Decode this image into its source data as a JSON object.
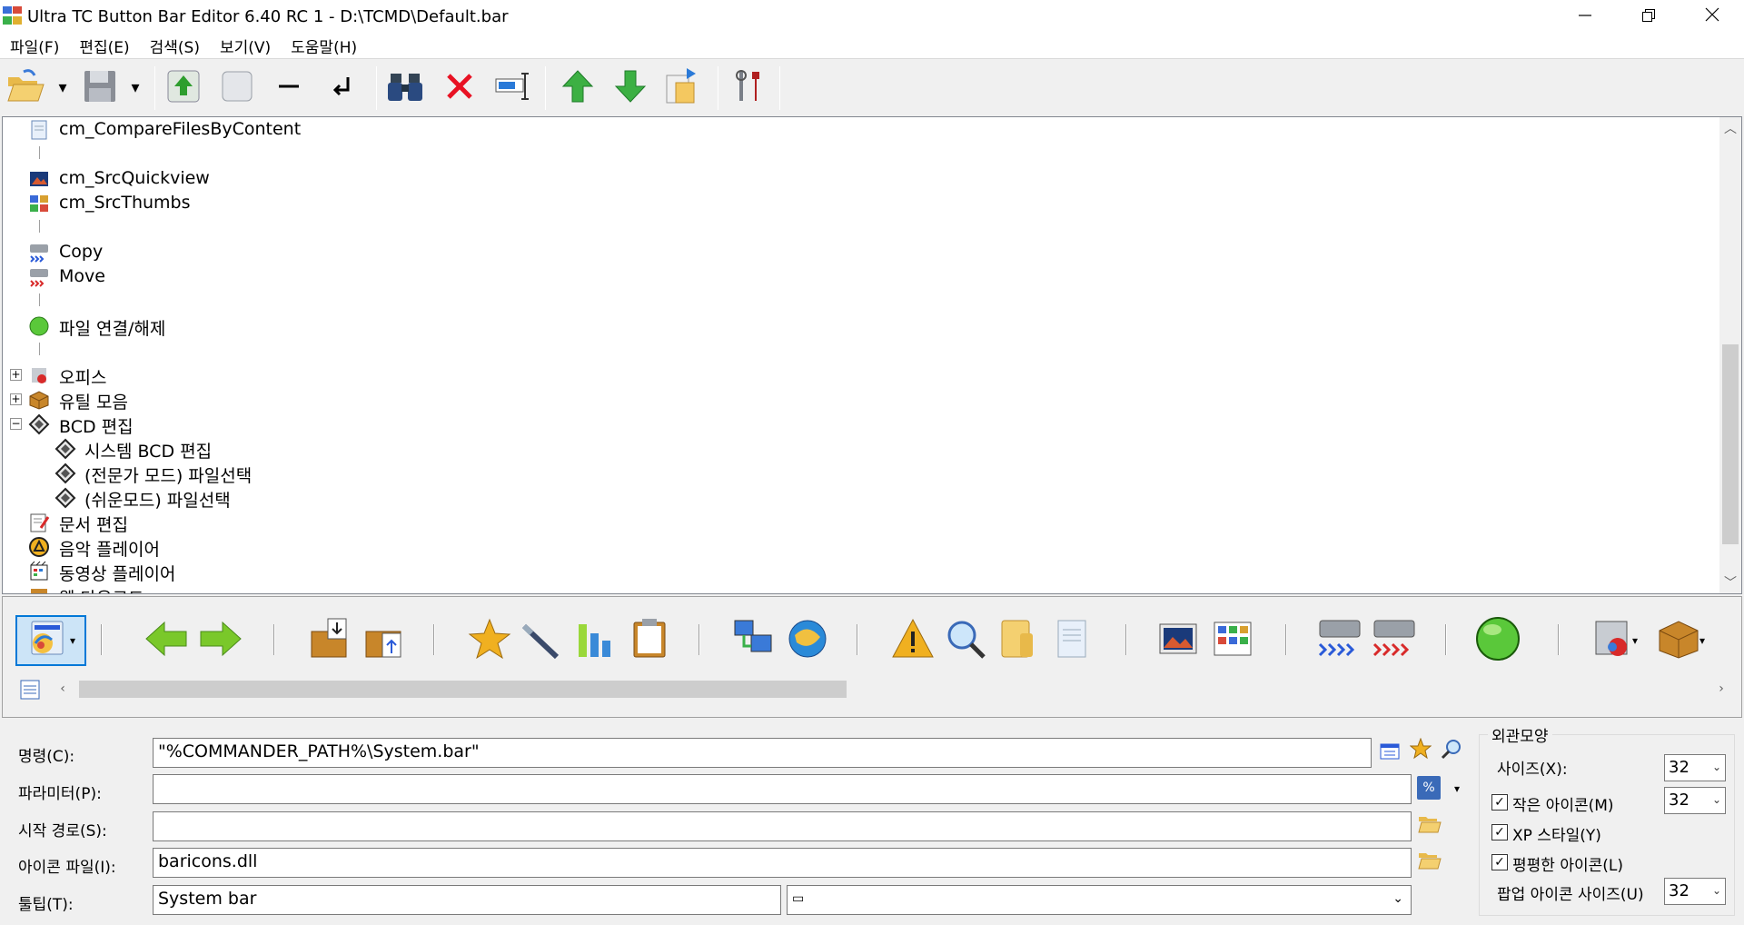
{
  "window": {
    "title": "Ultra TC Button Bar Editor 6.40 RC 1 - D:\\TCMD\\Default.bar"
  },
  "menu": [
    "파일(F)",
    "편집(E)",
    "검색(S)",
    "보기(V)",
    "도움말(H)"
  ],
  "tree": {
    "items": [
      {
        "label": "cm_CompareFilesByContent",
        "icon": "compare-files-icon"
      },
      {
        "label": "cm_SrcQuickview",
        "icon": "quickview-icon"
      },
      {
        "label": "cm_SrcThumbs",
        "icon": "thumbnails-icon"
      },
      {
        "label": "Copy",
        "icon": "copy-drive-icon"
      },
      {
        "label": "Move",
        "icon": "move-drive-icon"
      },
      {
        "label": "파일 연결/해제",
        "icon": "green-circle-icon"
      },
      {
        "label": "오피스",
        "icon": "office-icon"
      },
      {
        "label": "유틸 모음",
        "icon": "box-icon"
      },
      {
        "label": "BCD 편집",
        "icon": "diamond-icon"
      },
      {
        "label": "시스템 BCD 편집",
        "icon": "diamond-icon"
      },
      {
        "label": "(전문가 모드) 파일선택",
        "icon": "diamond-icon"
      },
      {
        "label": "(쉬운모드) 파일선택",
        "icon": "diamond-icon"
      },
      {
        "label": "문서 편집",
        "icon": "document-edit-icon"
      },
      {
        "label": "음악 플레이어",
        "icon": "music-player-icon"
      },
      {
        "label": "동영상 플레이어",
        "icon": "video-player-icon"
      },
      {
        "label": "웹 다운로드",
        "icon": "web-download-icon"
      }
    ],
    "expanders": {
      "office": "+",
      "utils": "+",
      "bcd": "−"
    }
  },
  "form": {
    "command_label": "명령(C):",
    "command_value": "\"%COMMANDER_PATH%\\System.bar\"",
    "params_label": "파라미터(P):",
    "params_value": "",
    "param_button": "%",
    "startpath_label": "시작 경로(S):",
    "startpath_value": "",
    "iconfile_label": "아이콘 파일(I):",
    "iconfile_value": "baricons.dll",
    "tooltip_label": "툴팁(T):",
    "tooltip_value": "System bar",
    "tooltip_combo_value": "▭"
  },
  "appearance": {
    "group_title": "외관모양",
    "size_label": "사이즈(X):",
    "size_value": "32",
    "small_icons_label": "작은 아이콘(M)",
    "small_icons_checked": true,
    "small_icons_value": "32",
    "xp_style_label": "XP 스타일(Y)",
    "xp_style_checked": true,
    "flat_icons_label": "평평한 아이콘(L)",
    "flat_icons_checked": true,
    "popup_size_label": "팝업 아이콘 사이즈(U)",
    "popup_size_value": "32"
  },
  "colors": {
    "accent": "#0078d7",
    "green_arrow": "#3cb043",
    "red_x": "#e81123"
  }
}
